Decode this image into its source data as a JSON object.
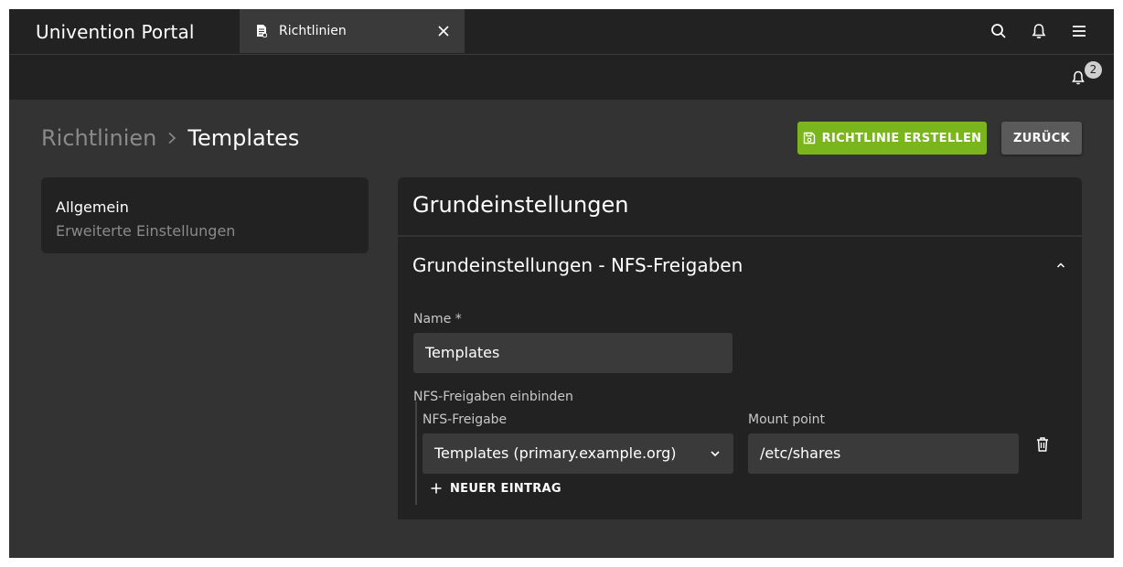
{
  "topbar": {
    "portal_title": "Univention Portal",
    "tab_label": "Richtlinien",
    "icons": [
      "search-icon",
      "bell-icon",
      "menu-icon",
      "close-icon",
      "document-icon"
    ]
  },
  "notifications": {
    "count": "2"
  },
  "header": {
    "breadcrumb_parent": "Richtlinien",
    "breadcrumb_current": "Templates",
    "create_button": "RICHTLINIE ERSTELLEN",
    "back_button": "ZURÜCK"
  },
  "sidenav": {
    "items": [
      {
        "label": "Allgemein",
        "active": true
      },
      {
        "label": "Erweiterte Einstellungen",
        "active": false
      }
    ]
  },
  "main": {
    "title": "Grundeinstellungen",
    "section_title": "Grundeinstellungen - NFS-Freigaben",
    "name_label": "Name *",
    "name_value": "Templates",
    "mounts_label": "NFS-Freigaben einbinden",
    "share_label": "NFS-Freigabe",
    "share_value": "Templates (primary.example.org)",
    "mount_label": "Mount point",
    "mount_value": "/etc/shares",
    "add_entry": "NEUER EINTRAG"
  },
  "colors": {
    "primary": "#7ab51d",
    "background": "#333333",
    "surface": "#222222",
    "input": "#3a3a3a"
  }
}
